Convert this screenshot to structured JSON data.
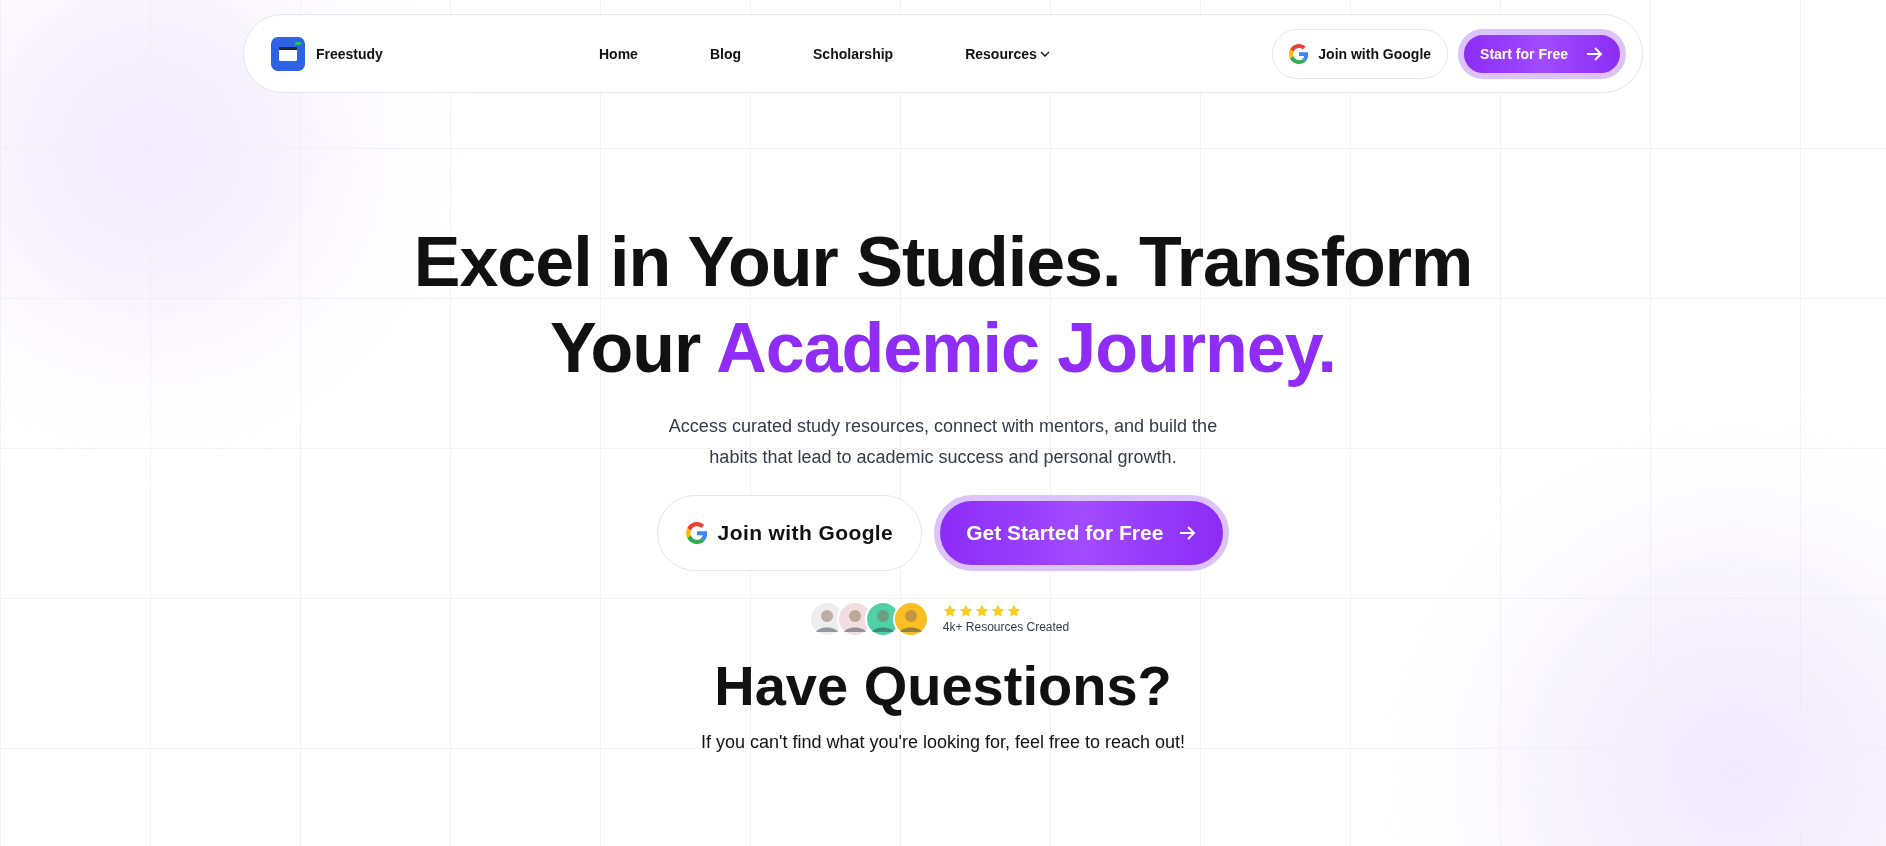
{
  "nav": {
    "brand": "Freestudy",
    "links": [
      {
        "label": "Home",
        "dropdown": false
      },
      {
        "label": "Blog",
        "dropdown": false
      },
      {
        "label": "Scholarship",
        "dropdown": false
      },
      {
        "label": "Resources",
        "dropdown": true
      }
    ],
    "google_button": "Join with Google",
    "cta_button": "Start for Free"
  },
  "hero": {
    "title_plain": "Excel in Your Studies. Transform Your ",
    "title_accent": "Academic Journey.",
    "subtitle": "Access curated study resources, connect with mentors, and build the habits that lead to academic success and personal growth.",
    "google_button": "Join with Google",
    "cta_button": "Get Started for Free",
    "avatars": [
      {
        "color": "#eeeeee"
      },
      {
        "color": "#f1dede"
      },
      {
        "color": "#4fd1a5"
      },
      {
        "color": "#fbbf24"
      }
    ],
    "stars": 5,
    "proof": "4k+ Resources Created"
  },
  "faq": {
    "title": "Have Questions?",
    "subtitle": "If you can't find what you're looking for, feel free to reach out!"
  }
}
